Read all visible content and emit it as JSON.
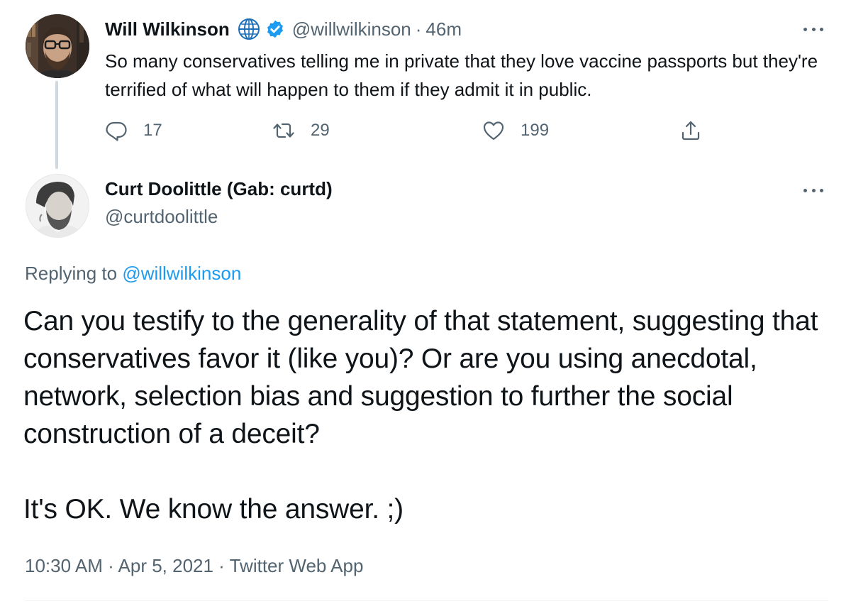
{
  "parent_tweet": {
    "author_name": "Will Wilkinson",
    "handle": "@willwilkinson",
    "separator": "·",
    "time_ago": "46m",
    "text": "So many conservatives telling me in private that they love vaccine passports but they're terrified of what will happen to them if they admit it in public.",
    "reply_count": "17",
    "retweet_count": "29",
    "like_count": "199",
    "icons": {
      "globe": "globe-icon",
      "verified": "verified-badge-icon",
      "reply": "reply-icon",
      "retweet": "retweet-icon",
      "like": "heart-icon",
      "share": "share-icon",
      "more": "more-icon"
    }
  },
  "main_tweet": {
    "author_name": "Curt Doolittle (Gab: curtd)",
    "handle": "@curtdoolittle",
    "replying_prefix": "Replying to",
    "replying_to": "@willwilkinson",
    "body_paragraph_1": "Can you testify to the generality of that statement, suggesting that conservatives favor it (like you)? Or are you using anecdotal, network, selection bias and suggestion to further the social construction of a deceit?",
    "body_paragraph_2": "It's OK. We know the answer. ;)",
    "meta": "10:30 AM · Apr 5, 2021 · Twitter Web App"
  },
  "colors": {
    "text_primary": "#0f1419",
    "text_secondary": "#536471",
    "link": "#1d9bf0",
    "verified": "#1d9bf0",
    "thread_line": "#cfd9de"
  }
}
